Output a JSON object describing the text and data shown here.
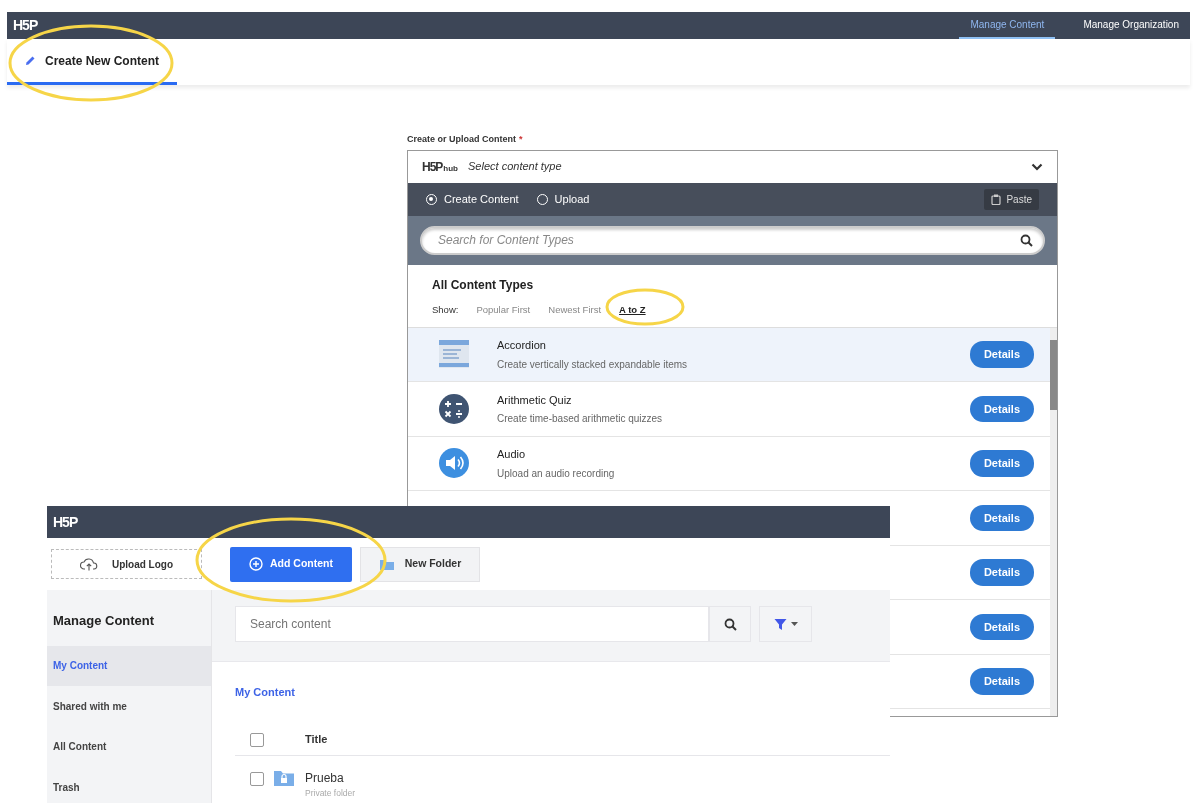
{
  "top_bar": {
    "logo": "H5P",
    "nav": [
      {
        "label": "Manage Content",
        "selected": true
      },
      {
        "label": "Manage Organization",
        "selected": false
      }
    ]
  },
  "tab": {
    "label": "Create New Content",
    "selected": true,
    "circled": true
  },
  "hub": {
    "label": "Create or Upload Content",
    "required_mark": "*",
    "logo": "H5P",
    "logo_sub": "hub",
    "title": "Select content type",
    "modes": [
      {
        "label": "Create Content",
        "selected": true
      },
      {
        "label": "Upload",
        "selected": false
      }
    ],
    "paste": "Paste",
    "search_placeholder": "Search for Content Types",
    "section_title": "All Content Types",
    "show_label": "Show:",
    "sorts": [
      {
        "label": "Popular First",
        "selected": false,
        "circled": false
      },
      {
        "label": "Newest First",
        "selected": false,
        "circled": false
      },
      {
        "label": "A to Z",
        "selected": true,
        "circled": true
      }
    ],
    "items": [
      {
        "kind": "accordion",
        "title": "Accordion",
        "description": "Create vertically stacked expandable items",
        "highlighted": true,
        "button": "Details"
      },
      {
        "kind": "arithmetic",
        "title": "Arithmetic Quiz",
        "description": "Create time-based arithmetic quizzes",
        "highlighted": false,
        "button": "Details"
      },
      {
        "kind": "audio",
        "title": "Audio",
        "description": "Upload an audio recording",
        "highlighted": false,
        "button": "Details"
      },
      {
        "kind": "covered",
        "button": "Details"
      },
      {
        "kind": "covered",
        "button": "Details"
      },
      {
        "kind": "covered",
        "button": "Details"
      },
      {
        "kind": "covered",
        "button": "Details"
      }
    ]
  },
  "manager": {
    "logo": "H5P",
    "upload_logo": "Upload Logo",
    "add_content": {
      "label": "Add Content",
      "circled": true
    },
    "new_folder": "New Folder",
    "sidebar": {
      "title": "Manage Content",
      "items": [
        {
          "label": "My Content",
          "selected": true
        },
        {
          "label": "Shared with me",
          "selected": false
        },
        {
          "label": "All Content",
          "selected": false
        },
        {
          "label": "Trash",
          "selected": false
        }
      ]
    },
    "search_placeholder": "Search content",
    "section_title": "My Content",
    "table": {
      "select_all_checked": false,
      "columns": [
        "Title"
      ],
      "rows": [
        {
          "title": "Prueba",
          "subtitle": "Private folder",
          "checked": false
        }
      ]
    }
  }
}
